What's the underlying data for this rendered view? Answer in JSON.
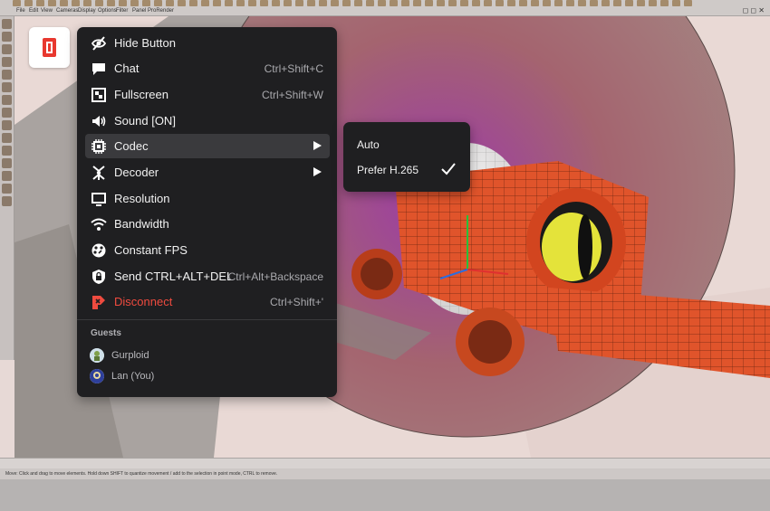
{
  "app": {
    "menubar": [
      "File",
      "Edit",
      "View",
      "Cameras",
      "Display",
      "Options",
      "Filter",
      "Panel",
      "ProRender"
    ],
    "status_text": "Move: Click and drag to move elements. Hold down SHIFT to quantize movement / add to the selection in point mode, CTRL to remove."
  },
  "menu": {
    "items": [
      {
        "icon": "eye-off-icon",
        "label": "Hide Button",
        "shortcut": ""
      },
      {
        "icon": "chat-icon",
        "label": "Chat",
        "shortcut": "Ctrl+Shift+C"
      },
      {
        "icon": "fullscreen-icon",
        "label": "Fullscreen",
        "shortcut": "Ctrl+Shift+W"
      },
      {
        "icon": "speaker-icon",
        "label": "Sound [ON]",
        "shortcut": ""
      },
      {
        "icon": "chip-icon",
        "label": "Codec",
        "shortcut": ""
      },
      {
        "icon": "decoder-icon",
        "label": "Decoder",
        "shortcut": ""
      },
      {
        "icon": "monitor-icon",
        "label": "Resolution",
        "shortcut": ""
      },
      {
        "icon": "wifi-icon",
        "label": "Bandwidth",
        "shortcut": ""
      },
      {
        "icon": "gauge-icon",
        "label": "Constant FPS",
        "shortcut": ""
      },
      {
        "icon": "shield-icon",
        "label": "Send CTRL+ALT+DEL",
        "shortcut": "Ctrl+Alt+Backspace"
      },
      {
        "icon": "disconnect-icon",
        "label": "Disconnect",
        "shortcut": "Ctrl+Shift+'"
      }
    ],
    "guests_heading": "Guests",
    "guests": [
      {
        "name": "Gurploid"
      },
      {
        "name": "Lan (You)"
      }
    ]
  },
  "submenu": {
    "options": [
      {
        "label": "Auto",
        "checked": false
      },
      {
        "label": "Prefer H.265",
        "checked": true
      }
    ]
  },
  "colors": {
    "menu_bg": "#1f1f21",
    "highlight": "#3a3a3d",
    "danger": "#ef4b3f",
    "brand": "#e8382f"
  }
}
